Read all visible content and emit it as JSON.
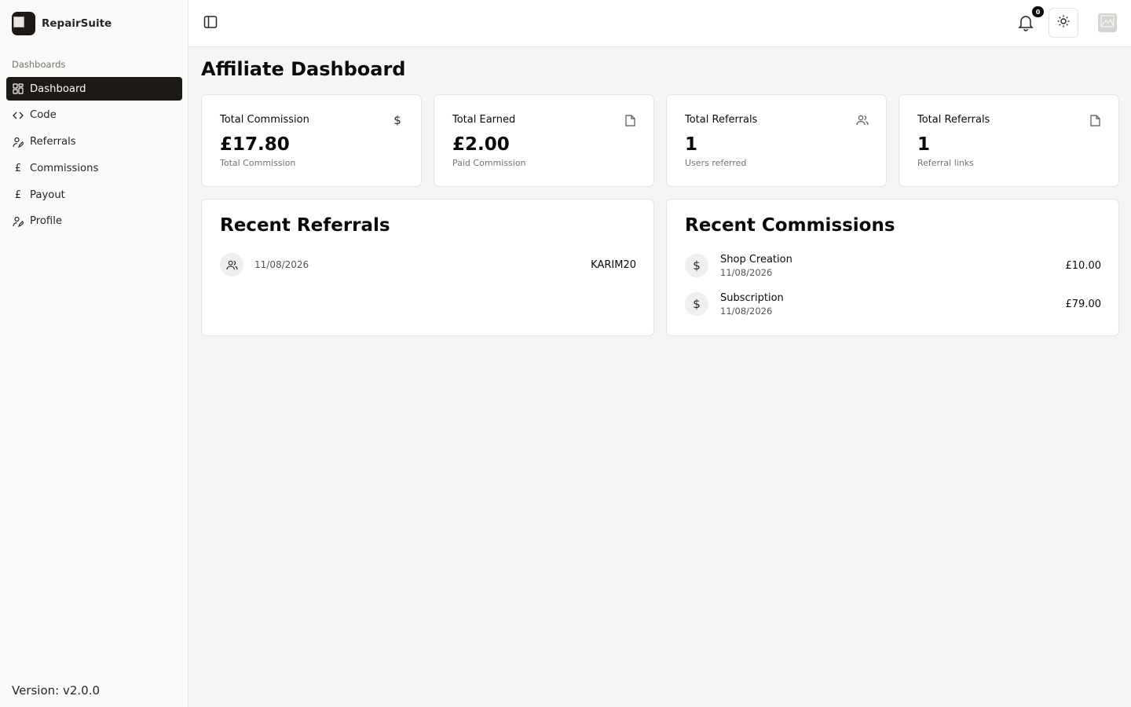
{
  "brand": {
    "name": "RepairSuite"
  },
  "sidebar": {
    "section_label": "Dashboards",
    "items": [
      {
        "label": "Dashboard",
        "icon": "grid-icon",
        "active": true
      },
      {
        "label": "Code",
        "icon": "code-icon"
      },
      {
        "label": "Referrals",
        "icon": "user-pen-icon"
      },
      {
        "label": "Commissions",
        "icon": "pound-icon"
      },
      {
        "label": "Payout",
        "icon": "pound-icon"
      },
      {
        "label": "Profile",
        "icon": "user-pen-icon"
      }
    ],
    "version": "Version: v2.0.0"
  },
  "header": {
    "notification_count": "0"
  },
  "page": {
    "title": "Affiliate Dashboard"
  },
  "stats": [
    {
      "label": "Total Commission",
      "value": "£17.80",
      "sub": "Total Commission",
      "icon": "dollar-icon"
    },
    {
      "label": "Total Earned",
      "value": "£2.00",
      "sub": "Paid Commission",
      "icon": "file-icon"
    },
    {
      "label": "Total Referrals",
      "value": "1",
      "sub": "Users referred",
      "icon": "users-icon"
    },
    {
      "label": "Total Referrals",
      "value": "1",
      "sub": "Referral links",
      "icon": "file-icon"
    }
  ],
  "recent_referrals": {
    "title": "Recent Referrals",
    "rows": [
      {
        "date": "11/08/2026",
        "code": "KARIM20"
      }
    ]
  },
  "recent_commissions": {
    "title": "Recent Commissions",
    "rows": [
      {
        "name": "Shop Creation",
        "date": "11/08/2026",
        "amount": "£10.00"
      },
      {
        "name": "Subscription",
        "date": "11/08/2026",
        "amount": "£79.00"
      }
    ]
  },
  "colors": {
    "accent": "#1c1917",
    "background": "#f5f5f4",
    "card": "#ffffff"
  }
}
